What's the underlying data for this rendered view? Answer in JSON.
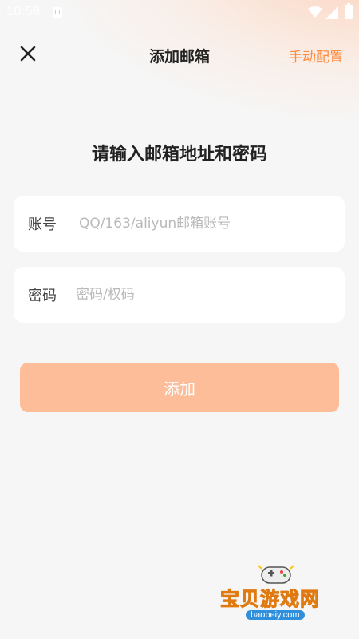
{
  "status_bar": {
    "time": "10:58"
  },
  "header": {
    "title": "添加邮箱",
    "manual_config": "手动配置"
  },
  "prompt": "请输入邮箱地址和密码",
  "form": {
    "account_label": "账号",
    "account_placeholder": "QQ/163/aliyun邮箱账号",
    "password_label": "密码",
    "password_placeholder": "密码/权码"
  },
  "add_button_label": "添加",
  "watermark": {
    "name": "宝贝游戏网",
    "url": "baobeiy.com"
  },
  "colors": {
    "accent": "#ff8a3d",
    "button_bg": "#fdbd98",
    "background": "#f6f6f6"
  }
}
